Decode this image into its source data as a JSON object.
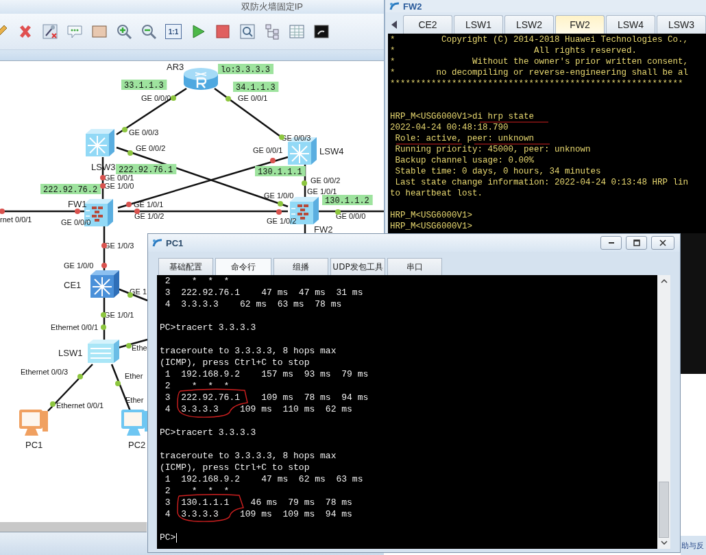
{
  "main_window": {
    "title": "双防火墙固定IP",
    "toolbar": {
      "fit_label": "1:1"
    }
  },
  "topology": {
    "devices": [
      {
        "label": "AR3",
        "kind": "router"
      },
      {
        "label": "LSW3",
        "kind": "core-switch"
      },
      {
        "label": "LSW4",
        "kind": "core-switch"
      },
      {
        "label": "FW1",
        "kind": "firewall"
      },
      {
        "label": "FW2",
        "kind": "firewall"
      },
      {
        "label": "CE1",
        "kind": "ce-switch"
      },
      {
        "label": "LSW1",
        "kind": "switch"
      },
      {
        "label": "PC1",
        "kind": "pc",
        "color": "#f0a060"
      },
      {
        "label": "PC2",
        "kind": "pc",
        "color": "#6ec6f2"
      }
    ],
    "ip_tags": [
      "lo:3.3.3.3",
      "33.1.1.3",
      "34.1.1.3",
      "222.92.76.1",
      "222.92.76.2",
      "130.1.1.1",
      "130.1.1.2"
    ],
    "port_labels": [
      "GE 0/0/0",
      "GE 0/0/1",
      "GE 0/0/3",
      "GE 0/0/2",
      "GE 0/0/1",
      "GE 1/0/0",
      "GE 0/0/3",
      "GE 0/0/1",
      "GE 0/0/2",
      "GE 1/0/1",
      "GE 1/0/0",
      "GE 1/0/2",
      "GE 0/0/0",
      "GE 1/0/1",
      "GE 1/0/2",
      "GE 0/0/0",
      "rnet 0/0/1",
      "GE 1/0/3",
      "GE 1/0/0",
      "GE 1",
      "GE 1/0/1",
      "Ethernet 0/0/1",
      "Ethe",
      "Ethernet 0/0/3",
      "Ether",
      "Ethernet 0/0/1",
      "Ether"
    ],
    "port_dots": [
      {
        "color": "#8dc63f"
      },
      {
        "color": "#8dc63f"
      },
      {
        "color": "#8dc63f"
      },
      {
        "color": "#8dc63f"
      },
      {
        "color": "#8dc63f"
      },
      {
        "color": "#8dc63f"
      },
      {
        "color": "#8dc63f"
      },
      {
        "color": "#8dc63f"
      },
      {
        "color": "#8dc63f"
      },
      {
        "color": "#8dc63f"
      },
      {
        "color": "#8dc63f"
      },
      {
        "color": "#8dc63f"
      },
      {
        "color": "#8dc63f"
      },
      {
        "color": "#8dc63f"
      },
      {
        "color": "#8dc63f"
      },
      {
        "color": "#d9534f"
      },
      {
        "color": "#d9534f"
      },
      {
        "color": "#d9534f"
      },
      {
        "color": "#d9534f"
      },
      {
        "color": "#d9534f"
      },
      {
        "color": "#d9534f"
      },
      {
        "color": "#d9534f"
      },
      {
        "color": "#d9534f"
      },
      {
        "color": "#d9534f"
      },
      {
        "color": "#d9534f"
      }
    ]
  },
  "fw2_window": {
    "title": "FW2",
    "tabs": [
      {
        "label": "CE2",
        "selected": false
      },
      {
        "label": "LSW1",
        "selected": false
      },
      {
        "label": "LSW2",
        "selected": false
      },
      {
        "label": "FW2",
        "selected": true
      },
      {
        "label": "LSW4",
        "selected": false
      },
      {
        "label": "LSW3",
        "selected": false
      }
    ],
    "terminal": [
      {
        "kind": "text",
        "text": "*         Copyright (C) 2014-2018 Huawei Technologies Co.,"
      },
      {
        "kind": "text",
        "text": "*                           All rights reserved."
      },
      {
        "kind": "text",
        "text": "*               Without the owner's prior written consent,"
      },
      {
        "kind": "text",
        "text": "*        no decompiling or reverse-engineering shall be al"
      },
      {
        "kind": "text",
        "text": "*********************************************************"
      },
      {
        "kind": "blank"
      },
      {
        "kind": "blank"
      },
      {
        "kind": "text",
        "text": "HRP_M<USG6000V1>di hrp state"
      },
      {
        "kind": "text",
        "text": "2022-04-24 00:48:18.790"
      },
      {
        "kind": "text",
        "text": " Role: active, peer: unknown"
      },
      {
        "kind": "text",
        "text": " Running priority: 45000, peer: unknown"
      },
      {
        "kind": "text",
        "text": " Backup channel usage: 0.00%"
      },
      {
        "kind": "text",
        "text": " Stable time: 0 days, 0 hours, 34 minutes"
      },
      {
        "kind": "text",
        "text": " Last state change information: 2022-04-24 0:13:48 HRP lin"
      },
      {
        "kind": "text",
        "text": "to heartbeat lost."
      },
      {
        "kind": "blank"
      },
      {
        "kind": "text",
        "text": "HRP_M<USG6000V1>"
      },
      {
        "kind": "text",
        "text": "HRP_M<USG6000V1>"
      }
    ]
  },
  "pc1_window": {
    "title": "PC1",
    "tabs": [
      {
        "label": "基础配置",
        "selected": false
      },
      {
        "label": "命令行",
        "selected": true
      },
      {
        "label": "组播",
        "selected": false
      },
      {
        "label": "UDP发包工具",
        "selected": false
      },
      {
        "label": "串口",
        "selected": false
      }
    ],
    "terminal": [
      {
        "kind": "text",
        "text": " 2    *  *  *"
      },
      {
        "kind": "text",
        "text": " 3  222.92.76.1    47 ms  47 ms  31 ms"
      },
      {
        "kind": "text",
        "text": " 4  3.3.3.3    62 ms  63 ms  78 ms"
      },
      {
        "kind": "blank"
      },
      {
        "kind": "text",
        "text": "PC>tracert 3.3.3.3"
      },
      {
        "kind": "blank"
      },
      {
        "kind": "text",
        "text": "traceroute to 3.3.3.3, 8 hops max"
      },
      {
        "kind": "text",
        "text": "(ICMP), press Ctrl+C to stop"
      },
      {
        "kind": "text",
        "text": " 1  192.168.9.2    157 ms  93 ms  79 ms"
      },
      {
        "kind": "text",
        "text": " 2    *  *  *"
      },
      {
        "kind": "text",
        "text": " 3  222.92.76.1    109 ms  78 ms  94 ms"
      },
      {
        "kind": "text",
        "text": " 4  3.3.3.3    109 ms  110 ms  62 ms"
      },
      {
        "kind": "blank"
      },
      {
        "kind": "text",
        "text": "PC>tracert 3.3.3.3"
      },
      {
        "kind": "blank"
      },
      {
        "kind": "text",
        "text": "traceroute to 3.3.3.3, 8 hops max"
      },
      {
        "kind": "text",
        "text": "(ICMP), press Ctrl+C to stop"
      },
      {
        "kind": "text",
        "text": " 1  192.168.9.2    47 ms  62 ms  63 ms"
      },
      {
        "kind": "text",
        "text": " 2    *  *  *"
      },
      {
        "kind": "text",
        "text": " 3  130.1.1.1    46 ms  79 ms  78 ms"
      },
      {
        "kind": "text",
        "text": " 4  3.3.3.3    109 ms  109 ms  94 ms"
      },
      {
        "kind": "blank"
      },
      {
        "kind": "prompt",
        "text": "PC>"
      }
    ]
  },
  "side_fragment": "助与反"
}
